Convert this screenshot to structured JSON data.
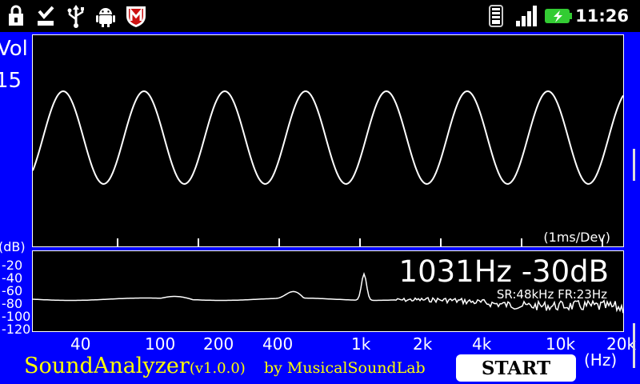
{
  "statusbar": {
    "time": "11:26",
    "icons": [
      "lock-icon",
      "download-done-icon",
      "usb-icon",
      "android-icon",
      "mcafee-shield-icon",
      "wifi-icon",
      "signal-icon",
      "battery-charging-icon"
    ],
    "colors": {
      "background": "#000000",
      "battery": "#33cc33",
      "mcafee": "#cc1111"
    }
  },
  "volume": {
    "label": "Vol",
    "value": "15"
  },
  "waveform": {
    "timebase": "(1ms/Dev)",
    "color": "#ffffff"
  },
  "spectrum": {
    "readout": "1031Hz -30dB",
    "rate": "SR:48kHz FR:23Hz",
    "db_label": "(dB)",
    "db_ticks": [
      "-20",
      "-40",
      "-60",
      "-80",
      "-100",
      "-120"
    ],
    "x_ticks": [
      "40",
      "100",
      "200",
      "400",
      "1k",
      "2k",
      "4k",
      "10k",
      "20k"
    ],
    "x_unit": "(Hz)"
  },
  "footer": {
    "app_name": "SoundAnalyzer",
    "version": "(v1.0.0)",
    "by": "by MusicalSoundLab",
    "start_label": "START"
  },
  "colors": {
    "background": "#0000ff",
    "panel": "#000000",
    "accent_text": "#ffff00",
    "button": "#ffffff"
  }
}
